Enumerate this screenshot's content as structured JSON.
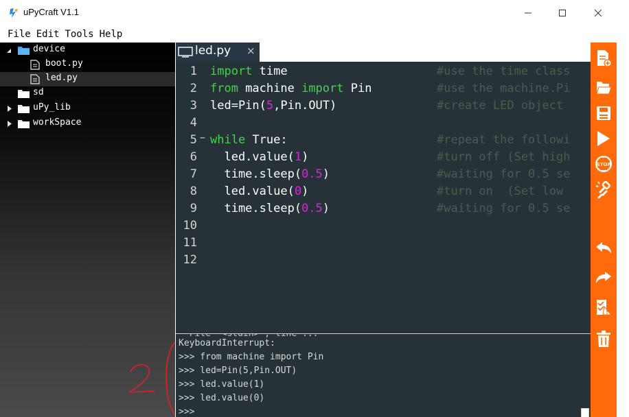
{
  "window": {
    "title": "uPyCraft V1.1"
  },
  "menu": [
    "File",
    "Edit",
    "Tools",
    "Help"
  ],
  "tree": [
    {
      "label": "device"
    },
    {
      "label": "boot.py"
    },
    {
      "label": "led.py"
    },
    {
      "label": "sd"
    },
    {
      "label": "uPy_lib"
    },
    {
      "label": "workSpace"
    }
  ],
  "tab": {
    "label": "led.py",
    "close": "×"
  },
  "code": {
    "line_numbers": [
      "1",
      "2",
      "3",
      "4",
      "5",
      "6",
      "7",
      "8",
      "9",
      "10",
      "11",
      "12"
    ],
    "comments": [
      "#use the time class",
      "#use the machine.Pi",
      "#create LED object",
      "",
      "#repeat the followi",
      "#turn off (Set high",
      "#waiting for 0.5 se",
      "#turn on  (Set low",
      "#waiting for 0.5 se"
    ],
    "tokens": {
      "l1_kw": "import",
      "l1_rest": " time",
      "l2_kw": "from",
      "l2_mid": " machine ",
      "l2_kw2": "import",
      "l2_rest": " Pin",
      "l3_pre": "led=Pin(",
      "l3_num": "5",
      "l3_post": ",Pin.OUT)",
      "l5_kw": "while",
      "l5_rest": " True:",
      "l6_pre": "  led.value(",
      "l6_num": "1",
      "l6_post": ")",
      "l7_pre": "  time.sleep(",
      "l7_num": "0.5",
      "l7_post": ")",
      "l8_pre": "  led.value(",
      "l8_num": "0",
      "l8_post": ")",
      "l9_pre": "  time.sleep(",
      "l9_num": "0.5",
      "l9_post": ")"
    }
  },
  "shell": {
    "cut_line": "  File \"<stdin>\", line ...",
    "lines": [
      "KeyboardInterrupt:",
      ">>> from machine import Pin",
      ">>> led=Pin(5,Pin.OUT)",
      ">>> led.value(1)",
      ">>> led.value(0)",
      ">>>"
    ]
  },
  "annotation": {
    "text": "2",
    "color": "#e02020"
  },
  "toolbar_icons": [
    "new-file-icon",
    "open-file-icon",
    "save-icon",
    "run-icon",
    "stop-icon",
    "connect-icon",
    "undo-icon",
    "redo-icon",
    "syntax-check-icon",
    "clear-icon"
  ],
  "colors": {
    "editor_bg": "#263238",
    "keyword": "#46d24b",
    "number": "#e020e0",
    "toolbar": "#ff6a0a"
  }
}
